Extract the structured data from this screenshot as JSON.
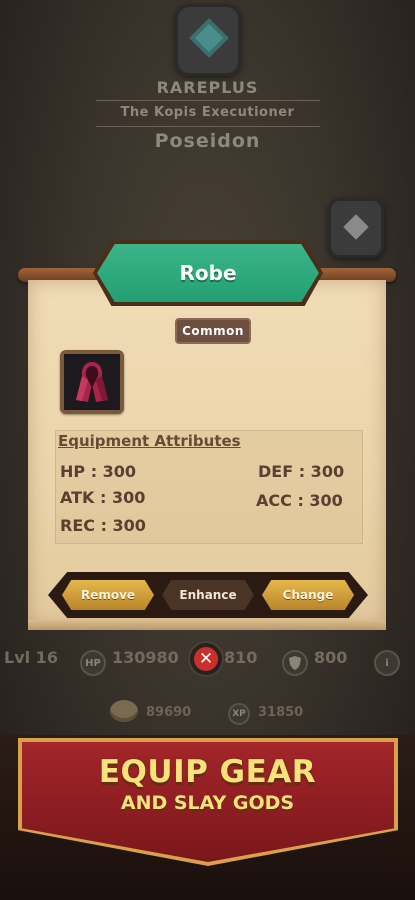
{
  "hero": {
    "rarity": "RAREPLUS",
    "title": "The Kopis Executioner",
    "name": "Poseidon",
    "slot_icon": "diamond-gem-icon"
  },
  "item_dialog": {
    "name": "Robe",
    "rarity": "Common",
    "icon": "robe-icon",
    "attributes_header": "Equipment Attributes",
    "attributes": {
      "hp": "HP : 300",
      "atk": "ATK : 300",
      "rec": "REC : 300",
      "def": "DEF :  300",
      "acc": "ACC : 300"
    },
    "buttons": {
      "remove": "Remove",
      "enhance": "Enhance",
      "change": "Change"
    },
    "colors": {
      "banner": "#23a073",
      "paper": "#ead4aa"
    }
  },
  "stats": {
    "level": "Lvl 16",
    "hp_icon": "HP",
    "hp_value": "130980",
    "atk_value": "810",
    "def_value": "800",
    "info_icon": "i"
  },
  "currency": {
    "gold": "89690",
    "xp_icon": "XP",
    "xp": "31850"
  },
  "promo": {
    "line1": "EQUIP GEAR",
    "line2": "AND SLAY GODS"
  }
}
